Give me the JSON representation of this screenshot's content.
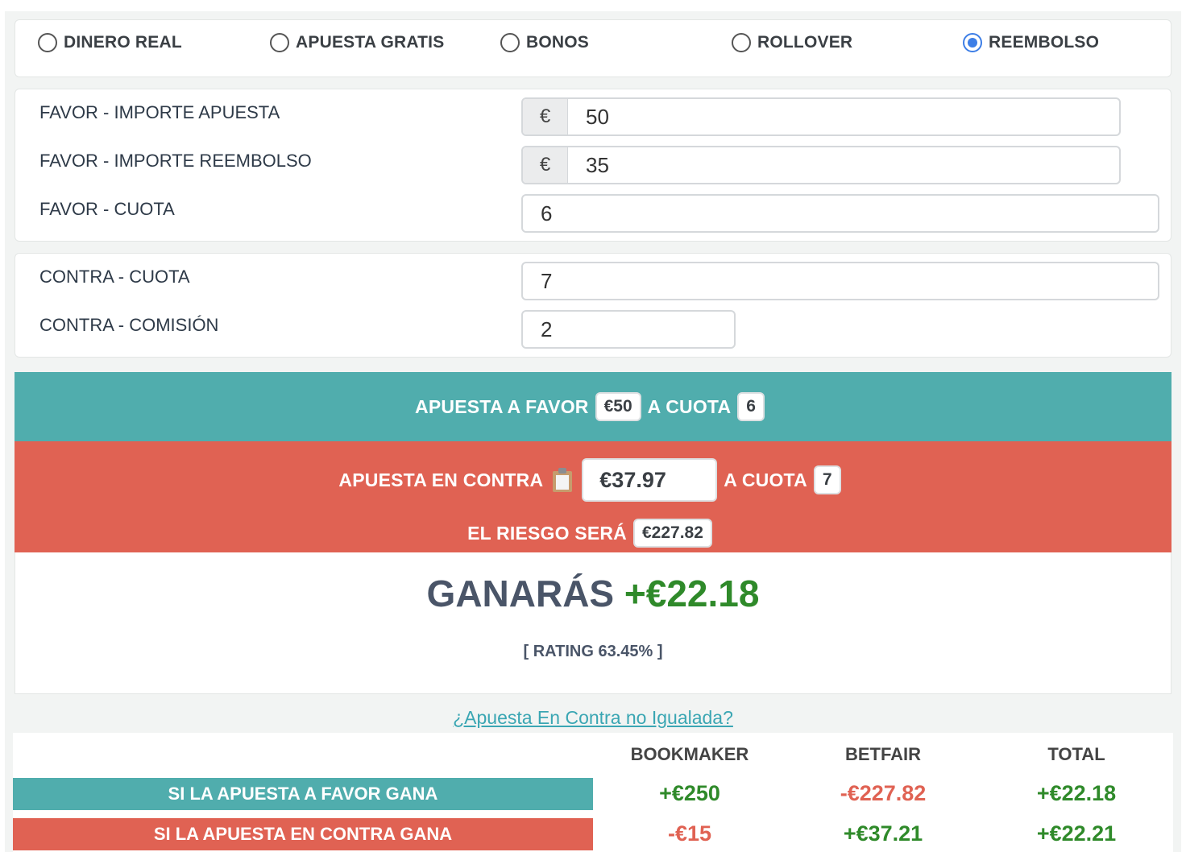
{
  "mode_options": [
    {
      "label": "DINERO REAL",
      "checked": false
    },
    {
      "label": "APUESTA GRATIS",
      "checked": false
    },
    {
      "label": "BONOS",
      "checked": false
    },
    {
      "label": "ROLLOVER",
      "checked": false
    },
    {
      "label": "REEMBOLSO",
      "checked": true
    }
  ],
  "favor": {
    "importe_apuesta_label": "FAVOR - IMPORTE APUESTA",
    "importe_apuesta_value": "50",
    "importe_reembolso_label": "FAVOR - IMPORTE REEMBOLSO",
    "importe_reembolso_value": "35",
    "cuota_label": "FAVOR - CUOTA",
    "cuota_value": "6",
    "currency_symbol": "€"
  },
  "contra": {
    "cuota_label": "CONTRA - CUOTA",
    "cuota_value": "7",
    "comision_label": "CONTRA - COMISIÓN",
    "comision_value": "2",
    "percent_symbol": "%"
  },
  "result": {
    "favor_text": "APUESTA A FAVOR",
    "favor_amount": "€50",
    "a_cuota_text": "A CUOTA",
    "favor_cuota": "6",
    "contra_text": "APUESTA EN CONTRA",
    "contra_amount": "€37.97",
    "contra_cuota": "7",
    "riesgo_text": "EL RIESGO SERÁ",
    "riesgo_amount": "€227.82",
    "ganaras_text": "GANARÁS",
    "ganaras_amount": "+€22.18",
    "rating_text": "[ RATING 63.45% ]",
    "clipboard_icon": "clipboard-icon"
  },
  "link_text": "¿Apuesta En Contra no Igualada?",
  "table": {
    "headers": [
      "BOOKMAKER",
      "BETFAIR",
      "TOTAL"
    ],
    "rows": [
      {
        "label": "SI LA APUESTA A FAVOR GANA",
        "bookmaker": "+€250",
        "betfair": "-€227.82",
        "total": "+€22.18"
      },
      {
        "label": "SI LA APUESTA EN CONTRA GANA",
        "bookmaker": "-€15",
        "betfair": "+€37.21",
        "total": "+€22.21"
      }
    ]
  },
  "colors": {
    "teal": "#50adad",
    "red": "#e06253",
    "green": "#2f8a2a",
    "radio_blue": "#3d7ee6"
  }
}
